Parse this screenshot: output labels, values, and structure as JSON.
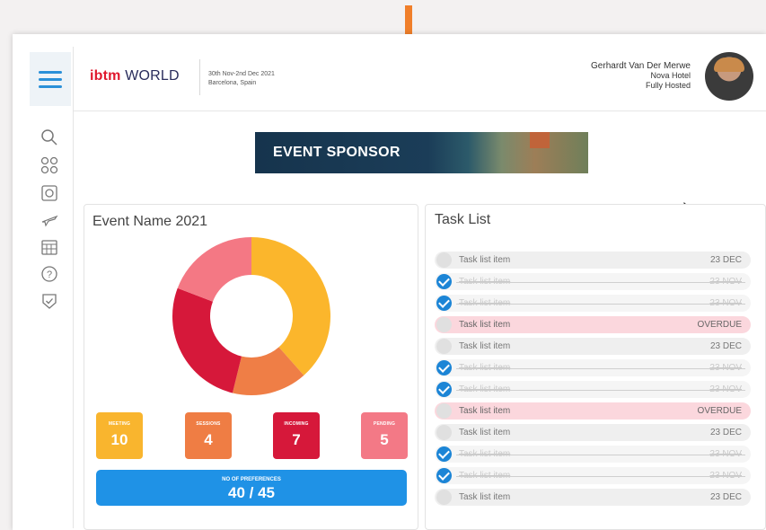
{
  "header": {
    "logo_bold": "ibtm",
    "logo_rest": " WORLD",
    "date_line1": "30th Nov-2nd Dec 2021",
    "date_line2": "Barcelona, Spain",
    "user_name": "Gerhardt Van Der Merwe",
    "user_hotel": "Nova Hotel",
    "user_status": "Fully Hosted"
  },
  "banner": {
    "label": "EVENT SPONSOR"
  },
  "sidebar": {
    "icons": [
      "search-icon",
      "apps-icon",
      "calendar-badge-icon",
      "flight-icon",
      "grid-calendar-icon",
      "help-icon",
      "shield-check-icon"
    ]
  },
  "event_card": {
    "title": "Event Name 2021",
    "stats": [
      {
        "label": "MEETING",
        "value": "10",
        "color": "#f9b52e"
      },
      {
        "label": "SESSIONS",
        "value": "4",
        "color": "#ef7d44"
      },
      {
        "label": "INCOMING",
        "value": "7",
        "color": "#d6183a"
      },
      {
        "label": "PENDING",
        "value": "5",
        "color": "#f37986"
      }
    ],
    "prefs_label": "NO OF PREFERENCES",
    "prefs_value": "40 / 45"
  },
  "chart_data": {
    "type": "pie",
    "categories": [
      "MEETING",
      "SESSIONS",
      "INCOMING",
      "PENDING"
    ],
    "values": [
      10,
      4,
      7,
      5
    ],
    "colors": [
      "#fbb62c",
      "#ef7e46",
      "#d6183a",
      "#f47884"
    ]
  },
  "task_card": {
    "title": "Task List",
    "items": [
      {
        "name": "Task list item",
        "due": "23 DEC",
        "state": "open"
      },
      {
        "name": "Task list item",
        "due": "23 NOV",
        "state": "done"
      },
      {
        "name": "Task list item",
        "due": "23 NOV",
        "state": "done"
      },
      {
        "name": "Task list item",
        "due": "OVERDUE",
        "state": "overdue"
      },
      {
        "name": "Task list item",
        "due": "23 DEC",
        "state": "open"
      },
      {
        "name": "Task list item",
        "due": "23 NOV",
        "state": "done"
      },
      {
        "name": "Task list item",
        "due": "23 NOV",
        "state": "done"
      },
      {
        "name": "Task list item",
        "due": "OVERDUE",
        "state": "overdue"
      },
      {
        "name": "Task list item",
        "due": "23 DEC",
        "state": "open"
      },
      {
        "name": "Task list item",
        "due": "23 NOV",
        "state": "done"
      },
      {
        "name": "Task list item",
        "due": "23 NOV",
        "state": "done"
      },
      {
        "name": "Task list item",
        "due": "23 DEC",
        "state": "open"
      }
    ]
  }
}
